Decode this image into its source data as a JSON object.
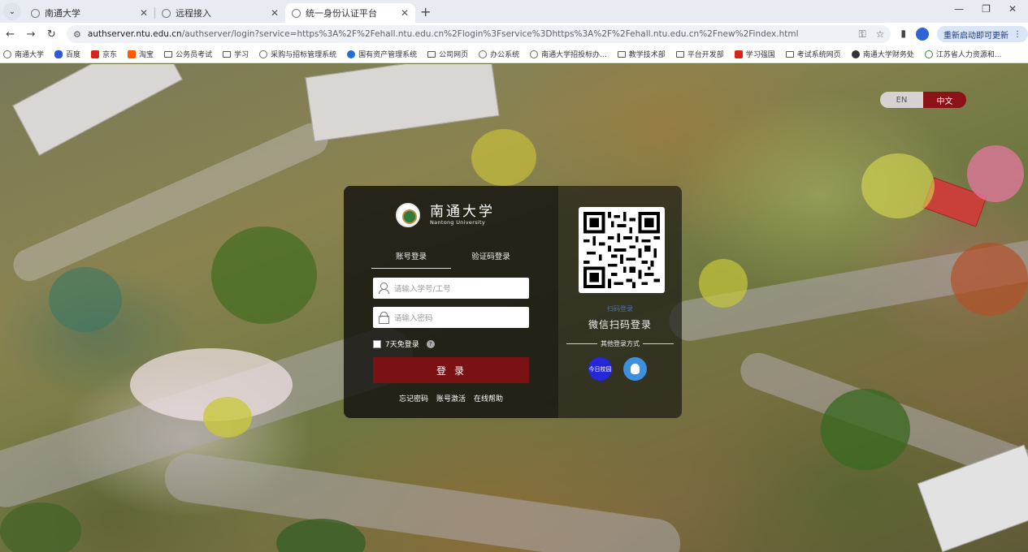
{
  "browser": {
    "tabs": [
      {
        "title": "南通大学",
        "active": false
      },
      {
        "title": "远程接入",
        "active": false
      },
      {
        "title": "统一身份认证平台",
        "active": true
      }
    ],
    "url_host": "authserver.ntu.edu.cn",
    "url_path": "/authserver/login?service=https%3A%2F%2Fehall.ntu.edu.cn%2Flogin%3Fservice%3Dhttps%3A%2F%2Fehall.ntu.edu.cn%2Fnew%2Findex.html",
    "update_label": "重新启动即可更新",
    "bookmarks": [
      {
        "label": "南通大学",
        "icon": "globe-icon"
      },
      {
        "label": "百度",
        "icon": "paw-icon"
      },
      {
        "label": "京东",
        "icon": "jd-icon"
      },
      {
        "label": "淘宝",
        "icon": "taobao-icon"
      },
      {
        "label": "公务员考试",
        "icon": "folder-icon"
      },
      {
        "label": "学习",
        "icon": "folder-icon"
      },
      {
        "label": "采购与招标管理系统",
        "icon": "globe-icon"
      },
      {
        "label": "国有资产管理系统",
        "icon": "globe-icon"
      },
      {
        "label": "公司网页",
        "icon": "folder-icon"
      },
      {
        "label": "办公系统",
        "icon": "globe-icon"
      },
      {
        "label": "南通大学招投标办...",
        "icon": "globe-icon"
      },
      {
        "label": "教学技术部",
        "icon": "folder-icon"
      },
      {
        "label": "平台开发部",
        "icon": "folder-icon"
      },
      {
        "label": "学习强国",
        "icon": "xuexi-icon"
      },
      {
        "label": "考试系统网页",
        "icon": "folder-icon"
      },
      {
        "label": "南通大学财务处",
        "icon": "globe-icon"
      },
      {
        "label": "江苏省人力资源和...",
        "icon": "globe-icon"
      }
    ]
  },
  "page": {
    "lang_en": "EN",
    "lang_zh": "中文",
    "logo_cn": "南通大学",
    "logo_en": "Nantong University",
    "tab_account": "账号登录",
    "tab_code": "验证码登录",
    "username_placeholder": "请输入学号/工号",
    "password_placeholder": "请输入密码",
    "remember_label": "7天免登录",
    "help_mark": "?",
    "login_label": "登录",
    "link_forgot": "忘记密码",
    "link_activate": "账号激活",
    "link_help": "在线帮助",
    "qr_tip": "扫码登录",
    "qr_title": "微信扫码登录",
    "other_methods": "其他登录方式",
    "jinri_label": "今日校园"
  },
  "colors": {
    "brand": "#7a1214",
    "lang_active": "#8b1317"
  }
}
